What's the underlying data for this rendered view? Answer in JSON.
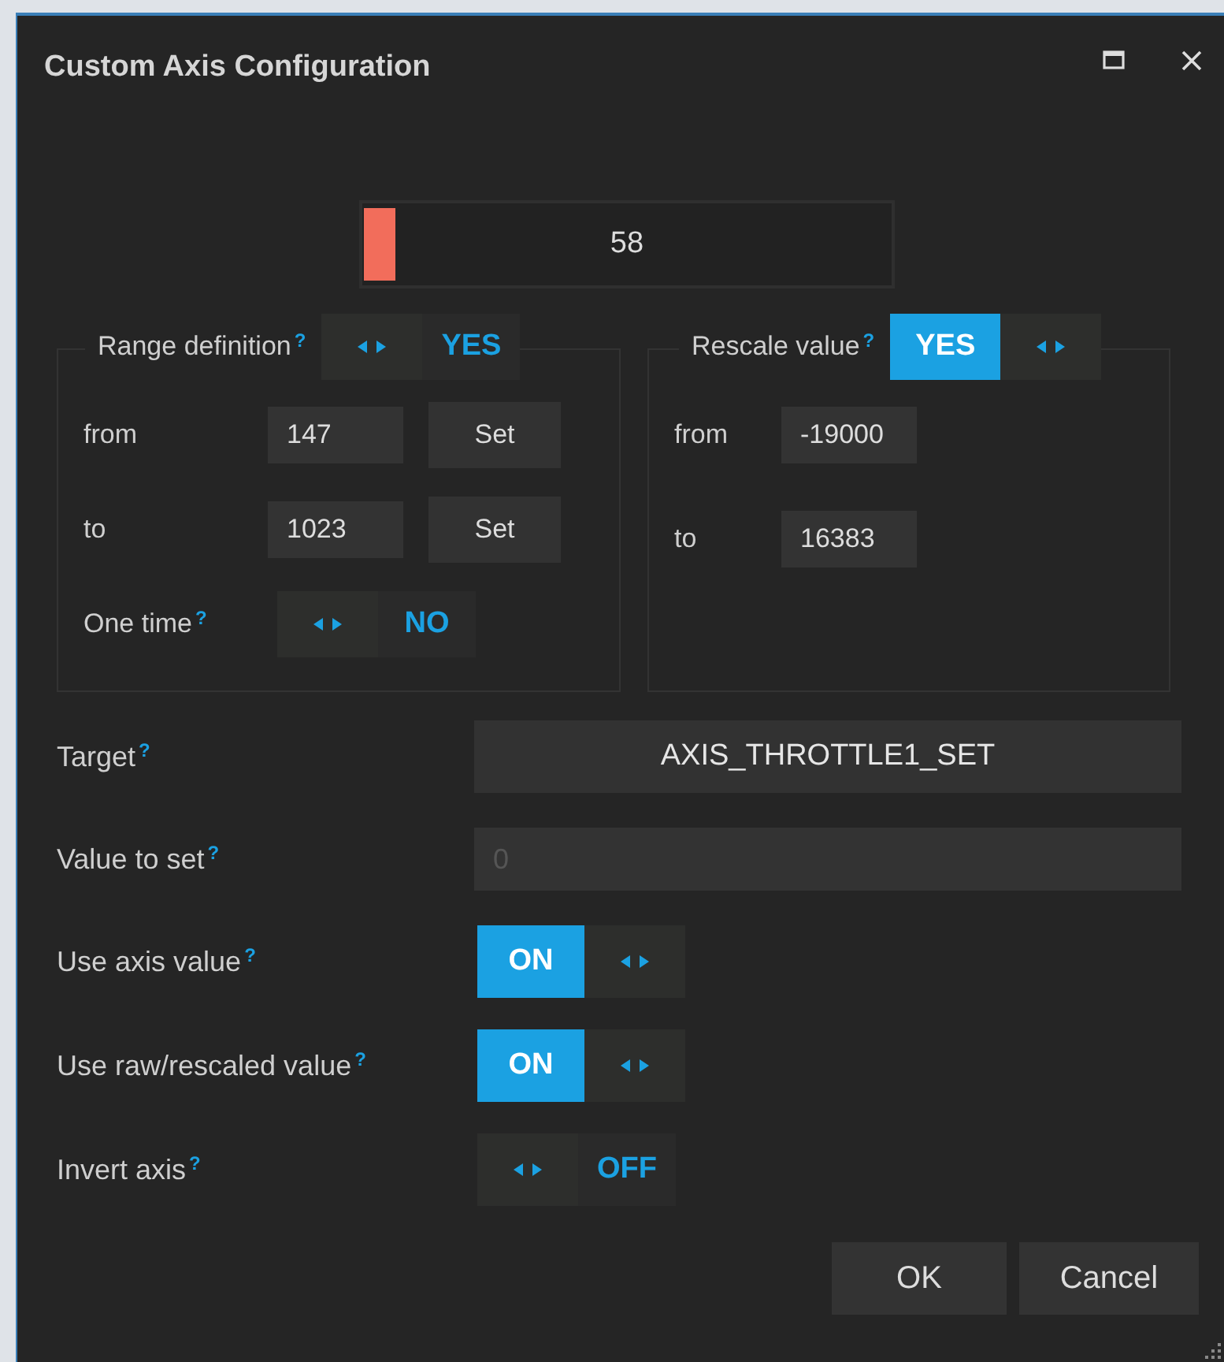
{
  "window": {
    "title": "Custom Axis Configuration"
  },
  "axis_value": {
    "reading": "58",
    "level": 0.06
  },
  "range_definition": {
    "label": "Range definition",
    "help": "?",
    "toggle": {
      "text": "YES",
      "on": false
    },
    "rows": [
      {
        "label": "from",
        "value": "147",
        "button": "Set"
      },
      {
        "label": "to",
        "value": "1023",
        "button": "Set"
      }
    ],
    "one_time": {
      "label": "One time",
      "help": "?",
      "toggle": {
        "text": "NO",
        "on": false
      }
    }
  },
  "rescale_value": {
    "label": "Rescale value",
    "help": "?",
    "toggle": {
      "text": "YES",
      "on": true
    },
    "rows": [
      {
        "label": "from",
        "value": "-19000"
      },
      {
        "label": "to",
        "value": "16383"
      }
    ]
  },
  "target": {
    "label": "Target",
    "help": "?",
    "value": "AXIS_THROTTLE1_SET"
  },
  "value_to_set": {
    "label": "Value to set",
    "help": "?",
    "value": "0",
    "disabled": true
  },
  "switches": [
    {
      "label": "Use axis value",
      "help": "?",
      "text": "ON",
      "on": true
    },
    {
      "label": "Use raw/rescaled value",
      "help": "?",
      "text": "ON",
      "on": true
    },
    {
      "label": "Invert axis",
      "help": "?",
      "text": "OFF",
      "on": false
    }
  ],
  "buttons": [
    "OK",
    "Cancel"
  ]
}
